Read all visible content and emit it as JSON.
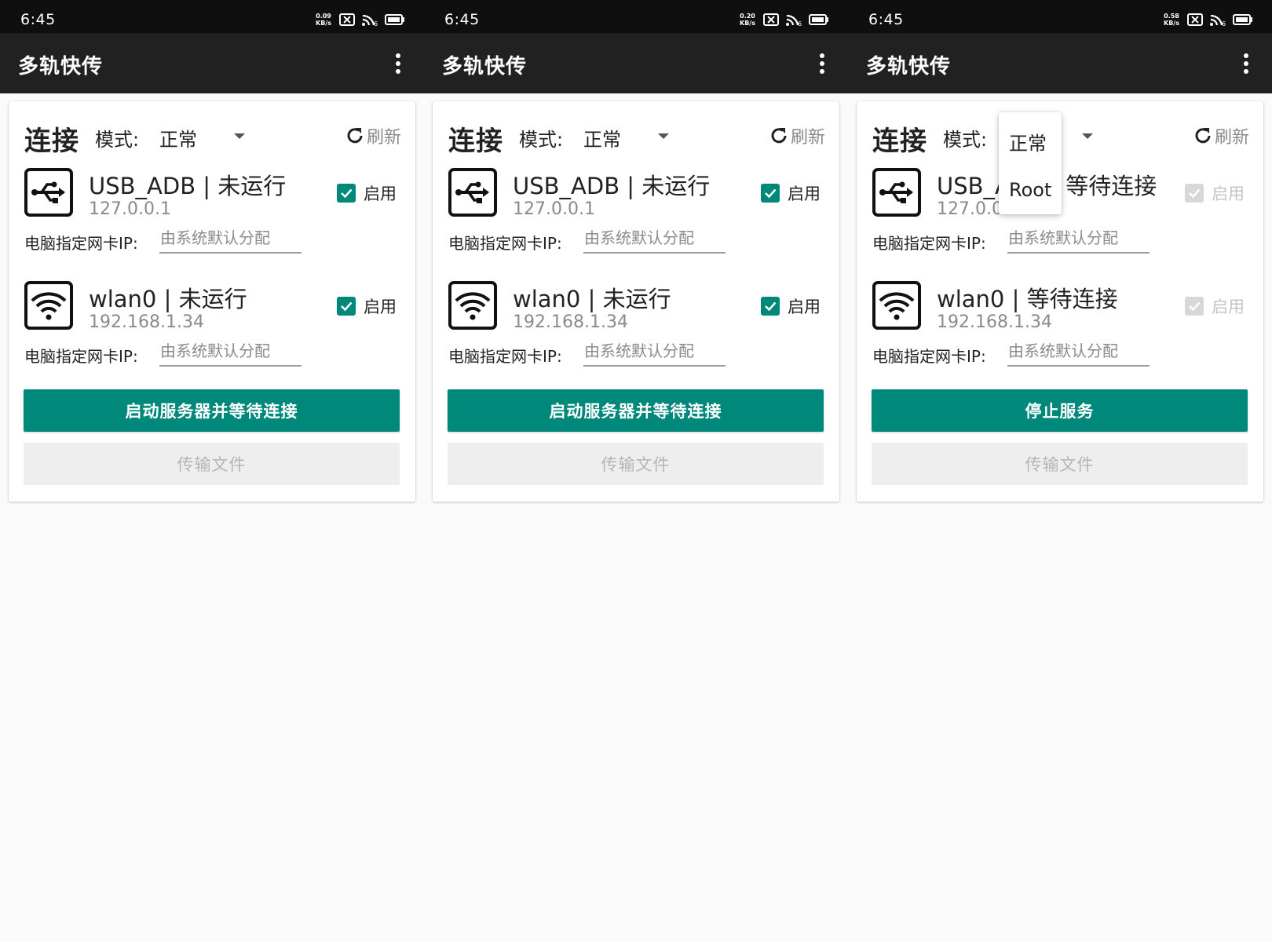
{
  "screens": [
    {
      "status": {
        "time": "6:45",
        "speed_value": "0.09",
        "speed_unit": "KB/s",
        "wifi_badge": "6"
      },
      "app_title": "多轨快传",
      "section_title": "连接",
      "mode_label": "模式:",
      "mode_value": "正常",
      "refresh_label": "刷新",
      "interfaces": [
        {
          "icon": "usb-icon",
          "title": "USB_ADB | 未运行",
          "ip": "127.0.0.1",
          "enabled": true,
          "enable_label": "启用",
          "nic_label": "电脑指定网卡IP:",
          "nic_placeholder": "由系统默认分配"
        },
        {
          "icon": "wifi-icon",
          "title": "wlan0 | 未运行",
          "ip": "192.168.1.34",
          "enabled": true,
          "enable_label": "启用",
          "nic_label": "电脑指定网卡IP:",
          "nic_placeholder": "由系统默认分配"
        }
      ],
      "primary_button": "启动服务器并等待连接",
      "secondary_button": "传输文件"
    },
    {
      "status": {
        "time": "6:45",
        "speed_value": "0.20",
        "speed_unit": "KB/s",
        "wifi_badge": "6"
      },
      "app_title": "多轨快传",
      "section_title": "连接",
      "mode_label": "模式:",
      "mode_value": "正常",
      "refresh_label": "刷新",
      "interfaces": [
        {
          "icon": "usb-icon",
          "title": "USB_ADB | 未运行",
          "ip": "127.0.0.1",
          "enabled": true,
          "enable_label": "启用",
          "nic_label": "电脑指定网卡IP:",
          "nic_placeholder": "由系统默认分配"
        },
        {
          "icon": "wifi-icon",
          "title": "wlan0 | 未运行",
          "ip": "192.168.1.34",
          "enabled": true,
          "enable_label": "启用",
          "nic_label": "电脑指定网卡IP:",
          "nic_placeholder": "由系统默认分配"
        }
      ],
      "primary_button": "启动服务器并等待连接",
      "secondary_button": "传输文件"
    },
    {
      "status": {
        "time": "6:45",
        "speed_value": "0.58",
        "speed_unit": "KB/s",
        "wifi_badge": "6"
      },
      "app_title": "多轨快传",
      "section_title": "连接",
      "mode_label": "模式:",
      "mode_value": "",
      "refresh_label": "刷新",
      "dropdown_open": true,
      "dropdown_options": [
        "正常",
        "Root"
      ],
      "interfaces": [
        {
          "icon": "usb-icon",
          "title": "USB_ADB | 等待连接",
          "ip": "127.0.0.1",
          "enabled": true,
          "disabled": true,
          "enable_label": "启用",
          "nic_label": "电脑指定网卡IP:",
          "nic_placeholder": "由系统默认分配"
        },
        {
          "icon": "wifi-icon",
          "title": "wlan0 | 等待连接",
          "ip": "192.168.1.34",
          "enabled": true,
          "disabled": true,
          "enable_label": "启用",
          "nic_label": "电脑指定网卡IP:",
          "nic_placeholder": "由系统默认分配"
        }
      ],
      "primary_button": "停止服务",
      "secondary_button": "传输文件"
    }
  ],
  "colors": {
    "accent": "#00897b",
    "app_bar": "#212121",
    "status_bar": "#0f0f0f",
    "background": "#fafafa"
  }
}
